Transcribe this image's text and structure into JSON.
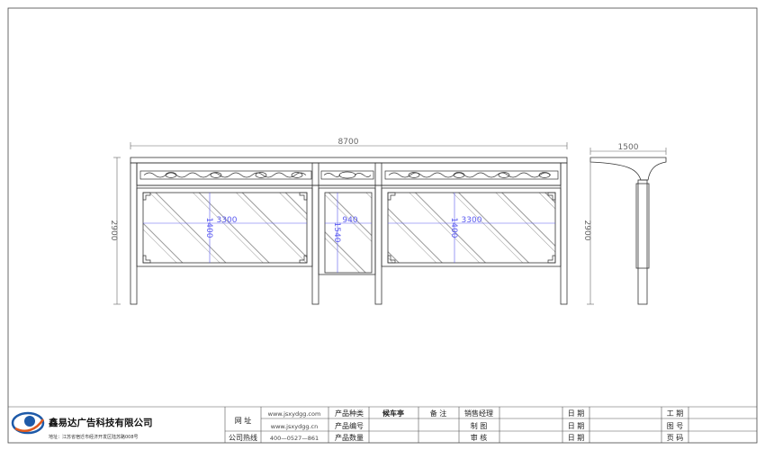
{
  "drawing": {
    "overall_width_label": "8700",
    "height_label_front": "2900",
    "panel_width_label_left": "3300",
    "panel_height_label_left": "1400",
    "center_width_label": "940",
    "center_height_label": "1540",
    "panel_width_label_right": "3300",
    "panel_height_label_right": "1400",
    "side_width_label": "1500",
    "height_label_side": "2900"
  },
  "title_block": {
    "company_name": "鑫易达广告科技有限公司",
    "address": "地址：江苏省宿迁市经济开发区陆苏路008号",
    "labels": {
      "website": "网 址",
      "hotline": "公司热线",
      "product_type": "产品种类",
      "product_code": "产品编号",
      "product_qty": "产品数量",
      "remark": "备 注",
      "sales_manager": "销售经理",
      "drawing": "制 图",
      "review": "审 核",
      "date1": "日 期",
      "date2": "日 期",
      "date3": "日 期",
      "job_no": "工 期",
      "drawing_no": "图 号",
      "page_no": "页 码"
    },
    "values": {
      "website_1": "www.jsxydgg.com",
      "website_2": "www.jsxydgg.cn",
      "hotline": "400—0527—861",
      "product_type": "候车亭"
    }
  }
}
